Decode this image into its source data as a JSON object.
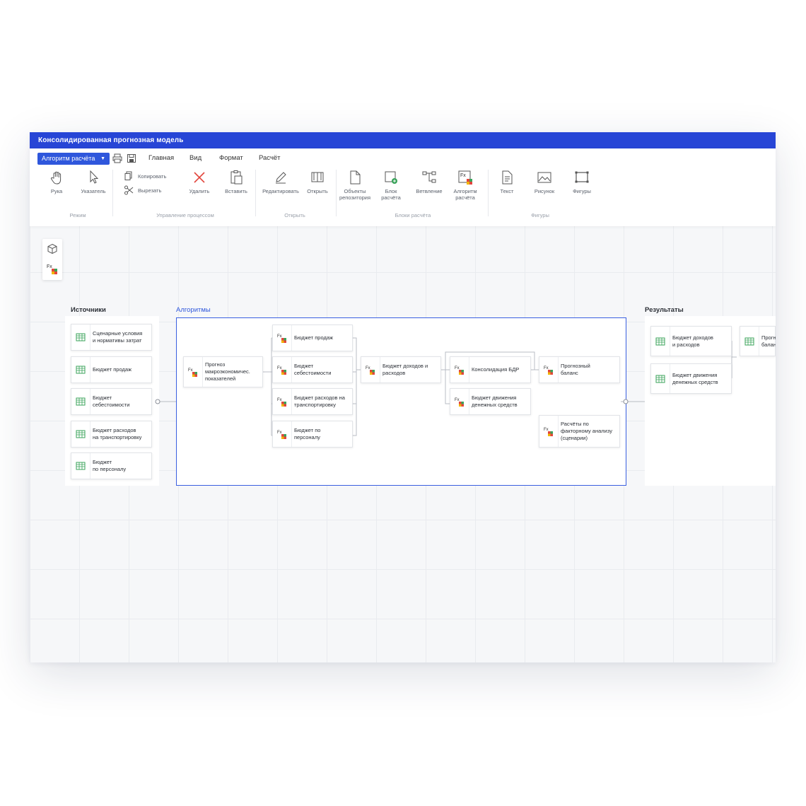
{
  "window": {
    "title": "Консолидированная прогнозная модель"
  },
  "menu": {
    "dropdown_label": "Алгоритм расчёта",
    "items": [
      "Главная",
      "Вид",
      "Формат",
      "Расчёт"
    ]
  },
  "toolbar": {
    "hand": "Рука",
    "pointer": "Указатель",
    "copy": "Копировать",
    "cut": "Вырезать",
    "delete": "Удалить",
    "paste": "Вставить",
    "edit": "Редактировать",
    "open": "Открыть",
    "repo_objects": [
      "Объекты",
      "репозитория"
    ],
    "calc_block": [
      "Блок",
      "расчёта"
    ],
    "branching": "Ветвление",
    "calc_algo": [
      "Алгоритм",
      "расчёта"
    ],
    "text": "Текст",
    "picture": "Рисунок",
    "shapes": "Фигуры",
    "groups": [
      "Режим",
      "Управление процессом",
      "Открыть",
      "Блоки расчёта",
      "Фигуры"
    ]
  },
  "sections": {
    "sources": "Источники",
    "algorithms": "Алгоритмы",
    "results": "Результаты"
  },
  "sources": [
    [
      "Сценарные условия",
      "и нормативы затрат"
    ],
    [
      "Бюджет продаж"
    ],
    [
      "Бюджет",
      "себестоимости"
    ],
    [
      "Бюджет расходов",
      "на транспортировку"
    ],
    [
      "Бюджет",
      "по персоналу"
    ]
  ],
  "algorithms": {
    "forecast": [
      "Прогноз",
      "макроэкономичес.",
      "показателей"
    ],
    "sales": [
      "Бюджет продаж"
    ],
    "cost": [
      "Бюджет",
      "себестоимости"
    ],
    "transport": [
      "Бюджет расходов на",
      "транспортировку"
    ],
    "personnel": [
      "Бюджет по",
      "персоналу"
    ],
    "income": [
      "Бюджет доходов и",
      "расходов"
    ],
    "consolidation": [
      "Консолидация БДР"
    ],
    "cashflow": [
      "Бюджет движения",
      "денежных средств"
    ],
    "balance": [
      "Прогнозный",
      "баланс"
    ],
    "factor": [
      "Расчёты по",
      "факторному анализу",
      "(сценарии)"
    ]
  },
  "results": [
    [
      "Бюджет доходов",
      "и расходов"
    ],
    [
      "Бюджет движения",
      "денежных средств"
    ],
    [
      "Прогн",
      "балан"
    ]
  ],
  "colors": {
    "accent": "#2f57dc",
    "title_bar": "#2745d6",
    "table_icon": "#3aa35a"
  }
}
